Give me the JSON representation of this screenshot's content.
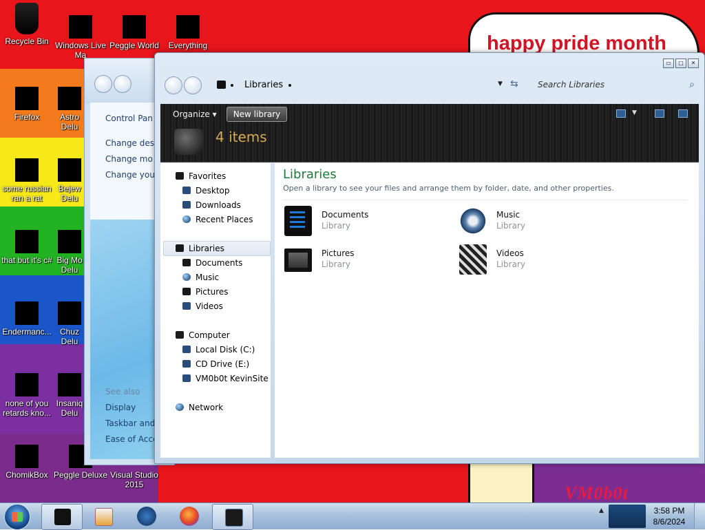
{
  "wallpaper": {
    "bubble_text": "happy pride month",
    "signature": "VM0b0t"
  },
  "desktop_icons": [
    {
      "label": "Recycle Bin",
      "label2": ""
    },
    {
      "label": "Windows Live",
      "label2": "Ma"
    },
    {
      "label": "Peggle World",
      "label2": ""
    },
    {
      "label": "Everything",
      "label2": ""
    },
    {
      "label": "Firefox",
      "label2": ""
    },
    {
      "label": "Astro",
      "label2": "Delu"
    },
    {
      "label": "some russian",
      "label2": "ran a rat"
    },
    {
      "label": "Bejew",
      "label2": "Delu"
    },
    {
      "label": "that but it's c#",
      "label2": ""
    },
    {
      "label": "Big Mo",
      "label2": "Delu"
    },
    {
      "label": "Endermanc...",
      "label2": ""
    },
    {
      "label": "Chuz",
      "label2": "Delu"
    },
    {
      "label": "none of you",
      "label2": "retards kno..."
    },
    {
      "label": "Insaniq",
      "label2": "Delu"
    },
    {
      "label": "ChomikBox",
      "label2": ""
    },
    {
      "label": "Peggle Deluxe",
      "label2": ""
    },
    {
      "label": "Visual Studio",
      "label2": "2015"
    }
  ],
  "control_panel": {
    "links": [
      "Control Pan",
      "Change desk",
      "Change mo",
      "Change you"
    ],
    "see_also": "See also",
    "see_also_links": [
      "Display",
      "Taskbar and",
      "Ease of Acce"
    ]
  },
  "explorer": {
    "caption_buttons": [
      "▭",
      "□",
      "✕"
    ],
    "breadcrumb": "Libraries",
    "search_placeholder": "Search Libraries",
    "organize_label": "Organize",
    "new_library_label": "New library",
    "item_count": "4 items",
    "nav": {
      "favorites": "Favorites",
      "favorites_items": [
        "Desktop",
        "Downloads",
        "Recent Places"
      ],
      "libraries": "Libraries",
      "libraries_items": [
        "Documents",
        "Music",
        "Pictures",
        "Videos"
      ],
      "computer": "Computer",
      "computer_items": [
        "Local Disk (C:)",
        "CD Drive (E:)",
        "VM0b0t KevinSite"
      ],
      "network": "Network"
    },
    "content_title": "Libraries",
    "content_desc": "Open a library to see your files and arrange them by folder, date, and other properties.",
    "libraries": [
      {
        "name": "Documents",
        "type": "Library",
        "icon": "documents-library-icon"
      },
      {
        "name": "Music",
        "type": "Library",
        "icon": "music-library-icon"
      },
      {
        "name": "Pictures",
        "type": "Library",
        "icon": "pictures-library-icon"
      },
      {
        "name": "Videos",
        "type": "Library",
        "icon": "videos-library-icon"
      }
    ]
  },
  "taskbar": {
    "clock_time": "3:58 PM",
    "clock_date": "8/6/2024"
  },
  "colors": {
    "accent_green": "#1e7a39",
    "item_count_gold": "#d9aa56",
    "bubble_red": "#d31424"
  }
}
